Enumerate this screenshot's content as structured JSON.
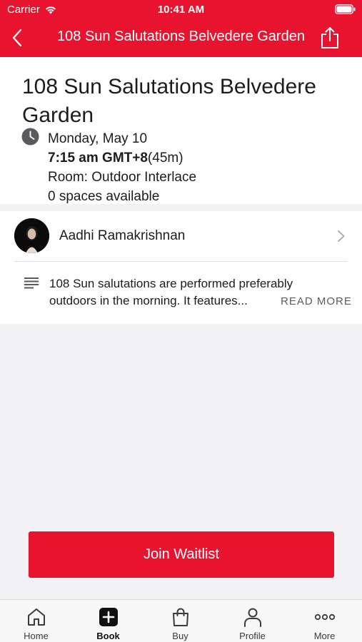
{
  "status_bar": {
    "carrier": "Carrier",
    "time": "10:41 AM"
  },
  "nav": {
    "title": "108 Sun Salutations Belvedere Garden",
    "back_icon": "chevron-left-icon",
    "share_icon": "share-icon"
  },
  "class_info": {
    "title": "108 Sun Salutations Belvedere Garden",
    "date": "Monday, May 10",
    "time": "7:15 am GMT+8",
    "duration": "(45m)",
    "room": "Room: Outdoor Interlace",
    "spaces": "0 spaces available"
  },
  "instructor": {
    "name": "Aadhi Ramakrishnan"
  },
  "description": {
    "line1": "108 Sun salutations are performed preferably",
    "line2": "outdoors in the morning. It features...",
    "read_more": "READ MORE"
  },
  "cta": {
    "label": "Join Waitlist"
  },
  "tabs": [
    {
      "label": "Home",
      "icon": "home-icon",
      "active": false
    },
    {
      "label": "Book",
      "icon": "plus-square-icon",
      "active": true
    },
    {
      "label": "Buy",
      "icon": "shopping-bag-icon",
      "active": false
    },
    {
      "label": "Profile",
      "icon": "person-icon",
      "active": false
    },
    {
      "label": "More",
      "icon": "more-dots-icon",
      "active": false
    }
  ],
  "colors": {
    "brand_red": "#e8132f",
    "background": "#f2f2f4",
    "text": "#1c1c1e"
  }
}
